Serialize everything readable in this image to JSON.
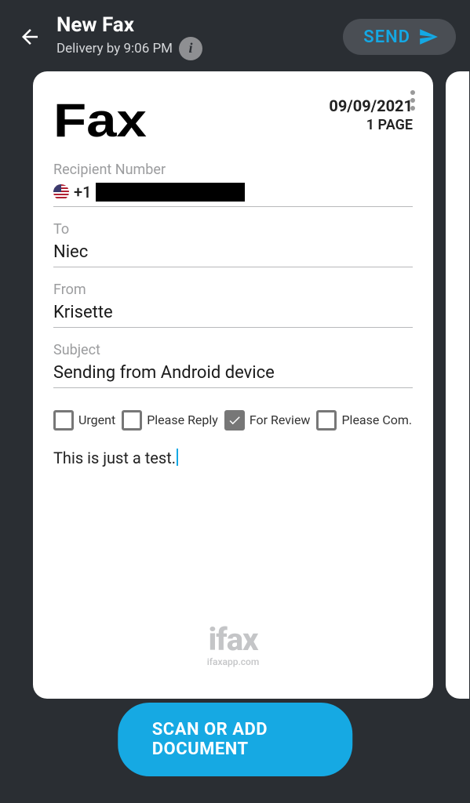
{
  "header": {
    "title": "New Fax",
    "subtitle": "Delivery by 9:06 PM",
    "send_label": "SEND"
  },
  "card": {
    "brand_word": "Fax",
    "date": "09/09/2021",
    "pages": "1 PAGE",
    "fields": {
      "recipient_label": "Recipient Number",
      "recipient_dial_code": "+1",
      "recipient_number_redacted": true,
      "to_label": "To",
      "to_value": "Niec",
      "from_label": "From",
      "from_value": "Krisette",
      "subject_label": "Subject",
      "subject_value": "Sending from Android device"
    },
    "checks": [
      {
        "name": "urgent",
        "label": "Urgent",
        "checked": false
      },
      {
        "name": "please-reply",
        "label": "Please Reply",
        "checked": false
      },
      {
        "name": "for-review",
        "label": "For Review",
        "checked": true
      },
      {
        "name": "please-comment",
        "label": "Please Com...",
        "checked": false
      }
    ],
    "message": "This is just a test.",
    "footer_brand": "ifax",
    "footer_url": "ifaxapp.com"
  },
  "scan_button_label": "SCAN OR ADD DOCUMENT"
}
